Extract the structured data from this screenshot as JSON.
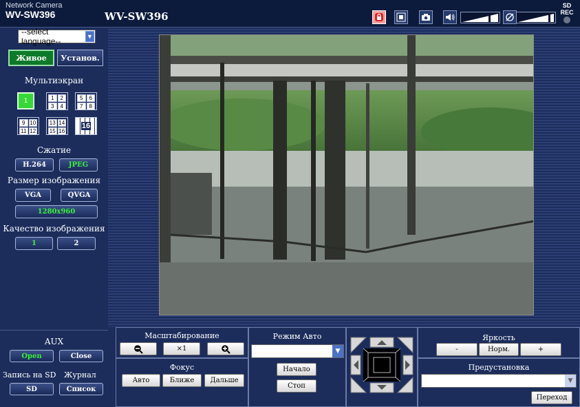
{
  "header": {
    "brand_line1": "Network Camera",
    "brand_line2": "WV-SW396",
    "page_title": "WV-SW396",
    "sd_rec": "SD REC"
  },
  "sidebar": {
    "language_select": "--select language--",
    "tabs": {
      "live": "Живое",
      "setup": "Установ."
    },
    "multiscreen": {
      "title": "Мультиэкран",
      "single": "1",
      "quad_a": [
        "1",
        "2",
        "3",
        "4"
      ],
      "quad_b": [
        "5",
        "6",
        "7",
        "8"
      ],
      "quad_c": [
        "9",
        "10",
        "11",
        "12"
      ],
      "quad_d": [
        "13",
        "14",
        "15",
        "16"
      ],
      "sixteen": "16"
    },
    "compression": {
      "title": "Сжатие",
      "h264": "H.264",
      "jpeg": "JPEG"
    },
    "image_size": {
      "title": "Размер изображения",
      "vga": "VGA",
      "qvga": "QVGA",
      "res": "1280x960"
    },
    "quality": {
      "title": "Качество изображения",
      "q1": "1",
      "q2": "2"
    },
    "aux": {
      "title": "AUX",
      "open": "Open",
      "close": "Close"
    },
    "sd": {
      "title": "Запись на SD",
      "button": "SD"
    },
    "log": {
      "title": "Журнал",
      "button": "Список"
    }
  },
  "controls": {
    "zoom": {
      "title": "Масштабирование",
      "x1": "×1"
    },
    "focus": {
      "title": "Фокус",
      "auto": "Авто",
      "near": "Ближе",
      "far": "Дальше"
    },
    "auto_mode": {
      "title": "Режим Авто",
      "value": "",
      "start": "Начало",
      "stop": "Стоп"
    },
    "brightness": {
      "title": "Яркость",
      "minus": "-",
      "normal": "Норм.",
      "plus": "+"
    },
    "preset": {
      "title": "Предустановка",
      "value": "",
      "go": "Переход"
    }
  },
  "colors": {
    "background": "#0c1a3c",
    "panel": "#1c2d5c",
    "active_green": "#38f038",
    "active_tab": "#0d7a2a"
  }
}
